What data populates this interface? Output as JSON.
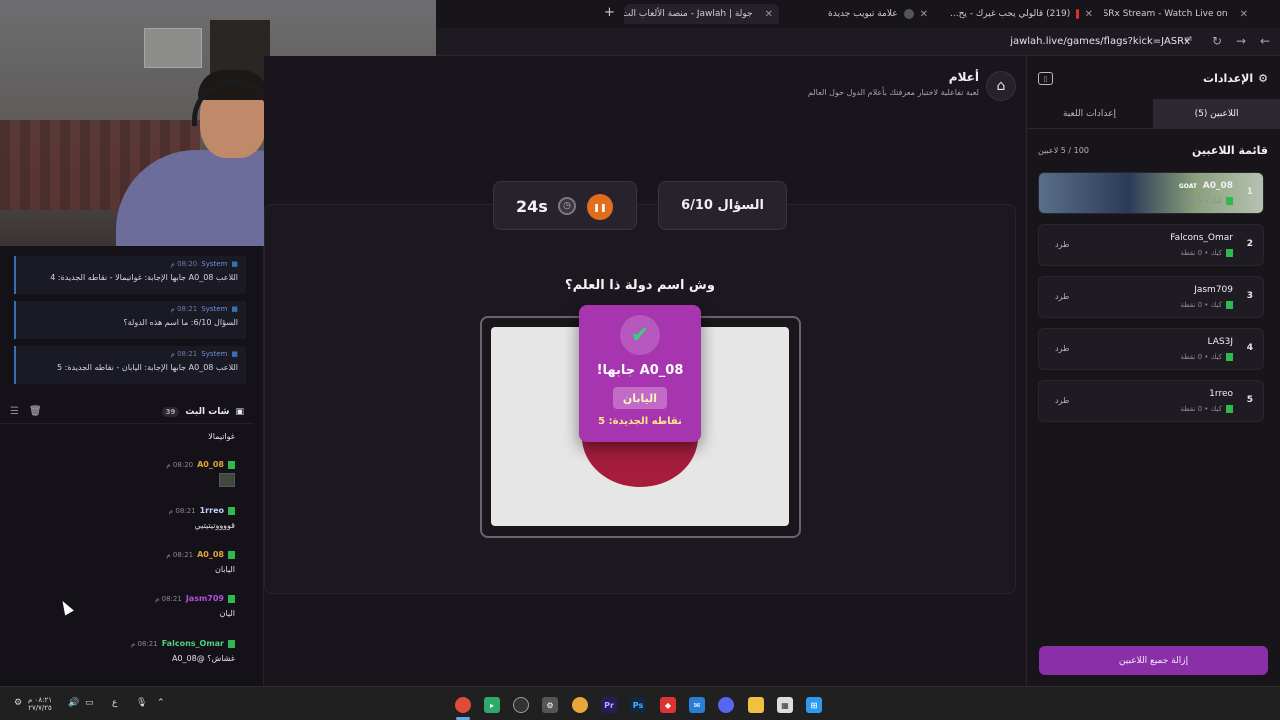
{
  "browser": {
    "tabs": [
      {
        "title": "JASRx Stream - Watch Live on",
        "active": false
      },
      {
        "title": "(219) قالولي يحب غيرك - يح...",
        "active": false
      },
      {
        "title": "علامة تبويب جديدة",
        "active": false
      },
      {
        "title": "جولة | Jawlah - منصة الألعاب الت...",
        "active": true
      }
    ],
    "url": "jawlah.live/games/flags?kick=JASRx"
  },
  "chat": {
    "system_messages": [
      {
        "name": "System",
        "time": "08:20 م",
        "text": "اللاعب A0_08 جابها الإجابة: غواتيمالا - نقاطه الجديدة: 4"
      },
      {
        "name": "System",
        "time": "08:21 م",
        "text": "السؤال 6/10: ما اسم هذه الدولة؟"
      },
      {
        "name": "System",
        "time": "08:21 م",
        "text": "اللاعب A0_08 جابها الإجابة: اليابان - نقاطه الجديدة: 5"
      }
    ],
    "title": "شات البث",
    "count": "39",
    "first_line": "غواتيمالا",
    "messages": [
      {
        "user": "A0_08",
        "time": "08:20 م",
        "text": "",
        "color": "#e0a53a"
      },
      {
        "user": "1rreo",
        "time": "08:21 م",
        "text": "قووووتيتيتيي",
        "color": "#c2d1ff"
      },
      {
        "user": "A0_08",
        "time": "08:21 م",
        "text": "اليابان",
        "color": "#e0a53a"
      },
      {
        "user": "Jasm709",
        "time": "08:21 م",
        "text": "اليان",
        "color": "#b44ee0"
      },
      {
        "user": "Falcons_Omar",
        "time": "08:21 م",
        "text": "غشاش؟ @A0_08",
        "color": "#4fd17a"
      }
    ]
  },
  "game": {
    "title": "أعلام",
    "subtitle": "لعبة تفاعلية لاختبار معرفتك بأعلام الدول حول العالم",
    "timer": "24s",
    "question_counter": "السؤال 6/10",
    "question": "وش اسم دولة ذا العلم؟",
    "popup": {
      "winner": "A0_08 جابها!",
      "answer": "اليابان",
      "points": "نقاطه الجديدة: 5"
    },
    "flag_colors": {
      "background": "#e6e6e6",
      "circle": "#a61d3b"
    }
  },
  "settings": {
    "title": "الإعدادات",
    "tabs": [
      {
        "label": "اللاعبين (5)",
        "active": true
      },
      {
        "label": "إعدادات اللعبة",
        "active": false
      }
    ],
    "list_title": "قائمة اللاعبين",
    "count": "100 / 5 لاعبين",
    "players": [
      {
        "rank": "1",
        "name": "A0_08",
        "badge": "GOAT",
        "sub": "كيك • 5 نقطة",
        "kick": ""
      },
      {
        "rank": "2",
        "name": "Falcons_Omar",
        "sub": "كيك • 0 نقطة",
        "kick": "طرد"
      },
      {
        "rank": "3",
        "name": "Jasm709",
        "sub": "كيك • 0 نقطة",
        "kick": "طرد"
      },
      {
        "rank": "4",
        "name": "LAS3J",
        "sub": "كيك • 0 نقطة",
        "kick": "طرد"
      },
      {
        "rank": "5",
        "name": "1rreo",
        "sub": "كيك • 0 نقطة",
        "kick": "طرد"
      }
    ],
    "remove_all": "إزالة جميع اللاعبين"
  },
  "taskbar": {
    "clock_time": "٠٨:٢١ م",
    "clock_date": "٢٧/٧/٢٥",
    "apps": [
      "chrome",
      "terminal",
      "obs",
      "settings",
      "chrome-alt",
      "premiere",
      "photoshop",
      "kick",
      "mail",
      "discord",
      "explorer",
      "store",
      "windows"
    ]
  }
}
